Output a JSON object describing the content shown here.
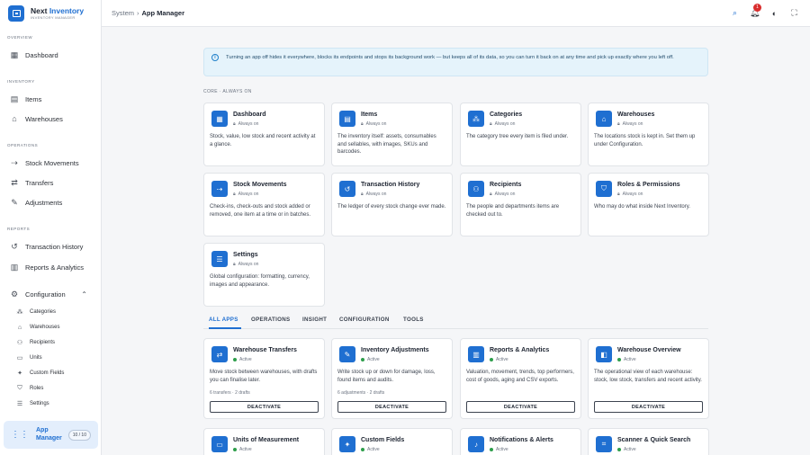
{
  "brand": {
    "name_part1": "Next",
    "name_part2": "Inventory",
    "subtitle": "INVENTORY MANAGER",
    "logo_icon": "inventory-box-icon"
  },
  "sidebar": {
    "sections": {
      "overview": "OVERVIEW",
      "inventory": "INVENTORY",
      "operations": "OPERATIONS",
      "reports": "REPORTS"
    },
    "items": {
      "dashboard": {
        "label": "Dashboard",
        "icon": "dashboard-icon"
      },
      "items": {
        "label": "Items",
        "icon": "archive-box-icon"
      },
      "warehouses": {
        "label": "Warehouses",
        "icon": "warehouse-icon"
      },
      "stock_movements": {
        "label": "Stock Movements",
        "icon": "flow-arrows-icon"
      },
      "transfers": {
        "label": "Transfers",
        "icon": "swap-arrows-icon"
      },
      "adjustments": {
        "label": "Adjustments",
        "icon": "wrench-icon"
      },
      "transaction_history": {
        "label": "Transaction History",
        "icon": "history-icon"
      },
      "reports_analytics": {
        "label": "Reports & Analytics",
        "icon": "bar-chart-icon"
      },
      "configuration": {
        "label": "Configuration",
        "icon": "gear-icon",
        "expanded": true
      }
    },
    "config_sub": {
      "categories": {
        "label": "Categories",
        "icon": "category-icon"
      },
      "warehouses": {
        "label": "Warehouses",
        "icon": "warehouse-icon"
      },
      "recipients": {
        "label": "Recipients",
        "icon": "people-icon"
      },
      "units": {
        "label": "Units",
        "icon": "ruler-icon"
      },
      "custom_fields": {
        "label": "Custom Fields",
        "icon": "puzzle-icon"
      },
      "roles": {
        "label": "Roles",
        "icon": "shield-icon"
      },
      "settings": {
        "label": "Settings",
        "icon": "sliders-icon"
      }
    },
    "app_manager": {
      "label": "App Manager",
      "badge": "10 / 10",
      "icon": "apps-grid-icon"
    }
  },
  "topbar": {
    "breadcrumb_root": "System",
    "breadcrumb_sep": "›",
    "breadcrumb_current": "App Manager",
    "notification_count": "1",
    "icons": [
      "search-icon",
      "bell-icon",
      "theme-toggle-icon",
      "fullscreen-icon"
    ]
  },
  "info_banner": {
    "text": "Turning an app off hides it everywhere, blocks its endpoints and stops its background work — but keeps all of its data, so you can turn it back on at any time and pick up exactly where you left off.",
    "icon": "info-icon"
  },
  "core": {
    "label": "CORE · ALWAYS ON",
    "cards": [
      {
        "title": "Dashboard",
        "status": "Always on",
        "desc": "Stock, value, low stock and recent activity at a glance.",
        "icon": "dashboard-icon"
      },
      {
        "title": "Items",
        "status": "Always on",
        "desc": "The inventory itself: assets, consumables and sellables, with images, SKUs and barcodes.",
        "icon": "archive-box-icon"
      },
      {
        "title": "Categories",
        "status": "Always on",
        "desc": "The category tree every item is filed under.",
        "icon": "category-icon"
      },
      {
        "title": "Warehouses",
        "status": "Always on",
        "desc": "The locations stock is kept in. Set them up under Configuration.",
        "icon": "warehouse-icon"
      },
      {
        "title": "Stock Movements",
        "status": "Always on",
        "desc": "Check-ins, check-outs and stock added or removed, one item at a time or in batches.",
        "icon": "flow-arrows-icon"
      },
      {
        "title": "Transaction History",
        "status": "Always on",
        "desc": "The ledger of every stock change ever made.",
        "icon": "history-icon"
      },
      {
        "title": "Recipients",
        "status": "Always on",
        "desc": "The people and departments items are checked out to.",
        "icon": "people-icon"
      },
      {
        "title": "Roles & Permissions",
        "status": "Always on",
        "desc": "Who may do what inside Next Inventory.",
        "icon": "shield-icon"
      },
      {
        "title": "Settings",
        "status": "Always on",
        "desc": "Global configuration: formatting, currency, images and appearance.",
        "icon": "sliders-icon"
      }
    ]
  },
  "tabs": [
    "ALL APPS",
    "OPERATIONS",
    "INSIGHT",
    "CONFIGURATION",
    "TOOLS"
  ],
  "apps": {
    "cards": [
      {
        "title": "Warehouse Transfers",
        "status": "Active",
        "desc": "Move stock between warehouses, with drafts you can finalise later.",
        "meta": "6 transfers · 2 drafts",
        "button": "DEACTIVATE",
        "icon": "swap-arrows-icon"
      },
      {
        "title": "Inventory Adjustments",
        "status": "Active",
        "desc": "Write stock up or down for damage, loss, found items and audits.",
        "meta": "6 adjustments · 2 drafts",
        "button": "DEACTIVATE",
        "icon": "wrench-icon"
      },
      {
        "title": "Reports & Analytics",
        "status": "Active",
        "desc": "Valuation, movement, trends, top performers, cost of goods, aging and CSV exports.",
        "meta": "",
        "button": "DEACTIVATE",
        "icon": "bar-chart-icon"
      },
      {
        "title": "Warehouse Overview",
        "status": "Active",
        "desc": "The operational view of each warehouse: stock, low stock, transfers and recent activity.",
        "meta": "",
        "button": "DEACTIVATE",
        "icon": "overview-icon"
      },
      {
        "title": "Units of Measurement",
        "status": "Active",
        "icon": "ruler-icon"
      },
      {
        "title": "Custom Fields",
        "status": "Active",
        "icon": "puzzle-icon"
      },
      {
        "title": "Notifications & Alerts",
        "status": "Active",
        "icon": "bell-icon"
      },
      {
        "title": "Scanner & Quick Search",
        "status": "Active",
        "icon": "scanner-icon"
      }
    ]
  },
  "colors": {
    "accent": "#1f6fd1",
    "active_dot": "#2e9e4b",
    "badge": "#d92d2d",
    "banner_bg": "#e5f3fb"
  }
}
